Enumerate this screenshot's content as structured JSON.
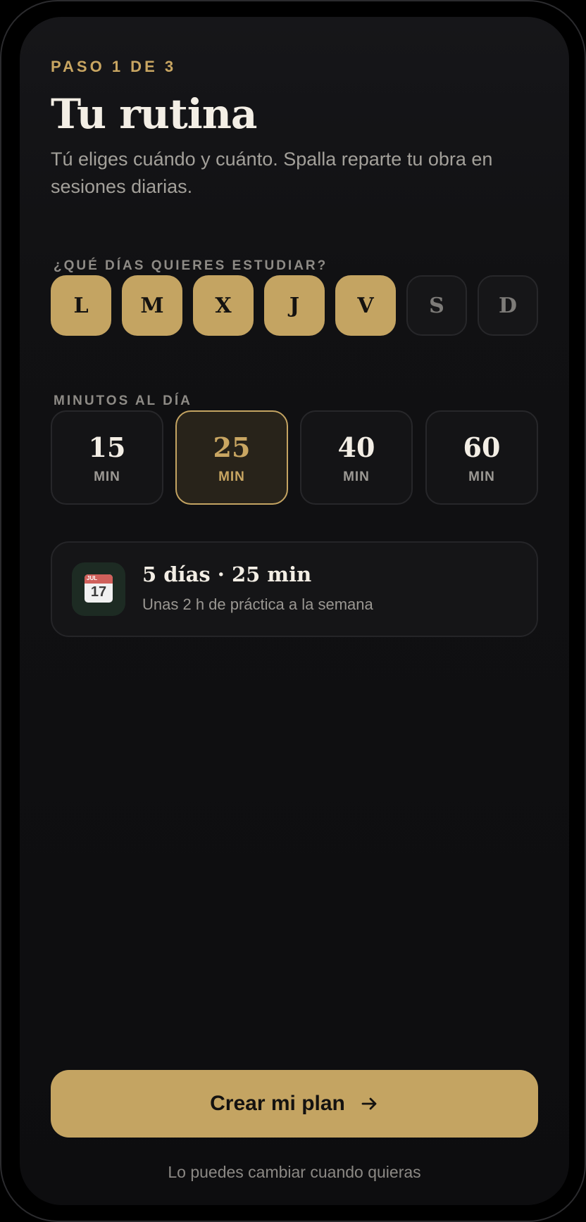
{
  "header": {
    "step": "PASO 1 DE 3",
    "title": "Tu rutina",
    "subtitle": "Tú eliges cuándo y cuánto. Spalla reparte tu obra en sesiones diarias."
  },
  "days_section": {
    "label": "¿QUÉ DÍAS QUIERES ESTUDIAR?",
    "days": [
      {
        "label": "L",
        "selected": true
      },
      {
        "label": "M",
        "selected": true
      },
      {
        "label": "X",
        "selected": true
      },
      {
        "label": "J",
        "selected": true
      },
      {
        "label": "V",
        "selected": true
      },
      {
        "label": "S",
        "selected": false
      },
      {
        "label": "D",
        "selected": false
      }
    ]
  },
  "minutes_section": {
    "label": "MINUTOS AL DÍA",
    "options": [
      {
        "value": "15",
        "unit": "MIN",
        "selected": false
      },
      {
        "value": "25",
        "unit": "MIN",
        "selected": true
      },
      {
        "value": "40",
        "unit": "MIN",
        "selected": false
      },
      {
        "value": "60",
        "unit": "MIN",
        "selected": false
      }
    ]
  },
  "summary": {
    "icon": "calendar-icon",
    "calendar_month": "JUL",
    "calendar_day": "17",
    "title": "5 días · 25 min",
    "subtitle": "Unas 2 h de práctica a la semana"
  },
  "cta": {
    "label": "Crear mi plan",
    "icon": "arrow-right-icon"
  },
  "footnote": "Lo puedes cambiar cuando quieras",
  "colors": {
    "accent": "#c4a462",
    "accent_text": "#c9a662",
    "background": "#0d0d0f",
    "selected_card_bg": "#28231a"
  }
}
